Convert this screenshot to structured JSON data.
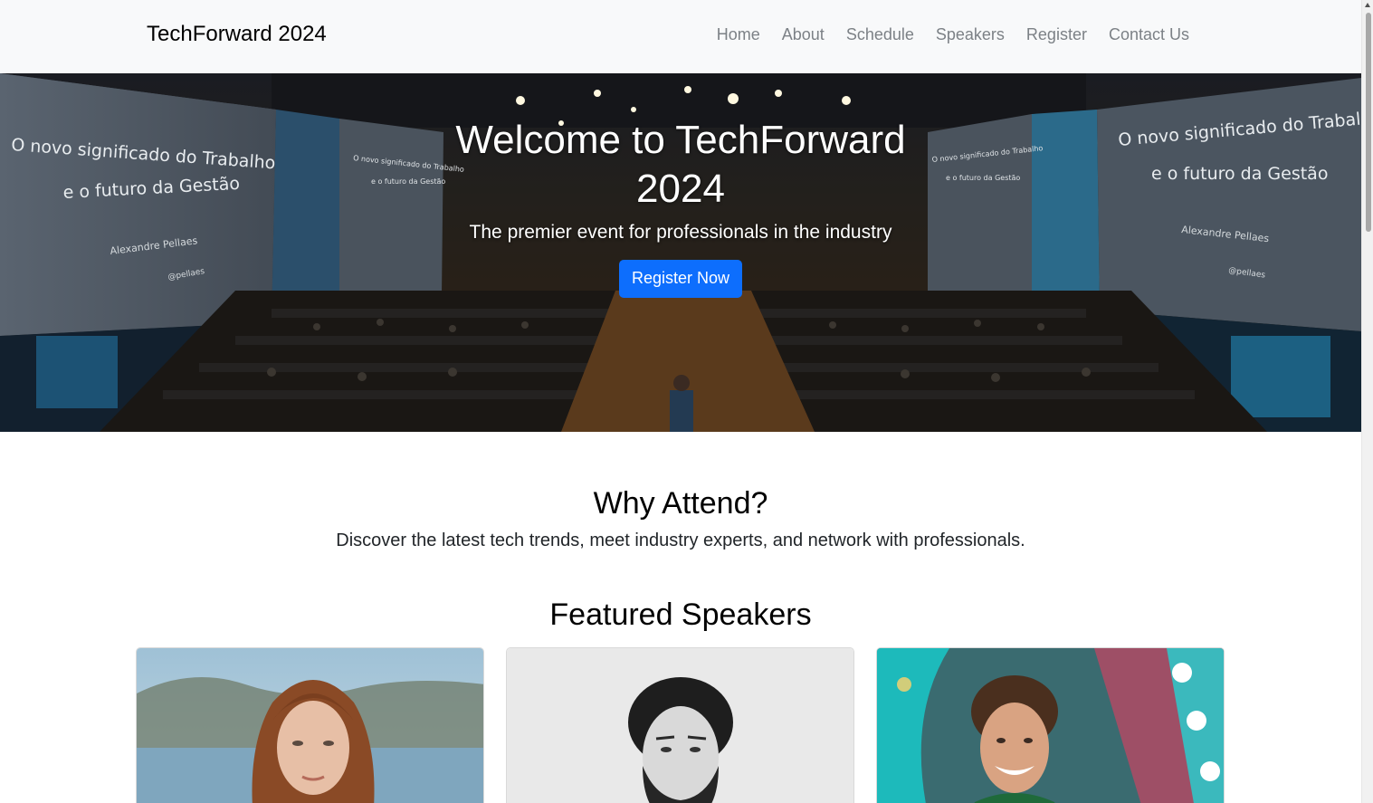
{
  "navbar": {
    "brand": "TechForward 2024",
    "links": [
      "Home",
      "About",
      "Schedule",
      "Speakers",
      "Register",
      "Contact Us"
    ]
  },
  "hero": {
    "title": "Welcome to TechForward 2024",
    "subtitle": "The premier event for professionals in the industry",
    "cta_label": "Register Now",
    "screen_text": {
      "line1": "O novo significado do Trabalho",
      "line2": "e o futuro da Gestão",
      "presenter": "Alexandre Pellaes",
      "handle": "@pellaes"
    }
  },
  "why": {
    "title": "Why Attend?",
    "text": "Discover the latest tech trends, meet industry experts, and network with professionals."
  },
  "speakers": {
    "title": "Featured Speakers",
    "cards": [
      {
        "photo": "woman-portrait-photo"
      },
      {
        "photo": "man-bw-portrait-photo"
      },
      {
        "photo": "man-smiling-portrait-photo"
      }
    ]
  },
  "colors": {
    "primary": "#0d6efd",
    "navbar_bg": "#f8f9fa",
    "nav_link": "#7c8186"
  }
}
